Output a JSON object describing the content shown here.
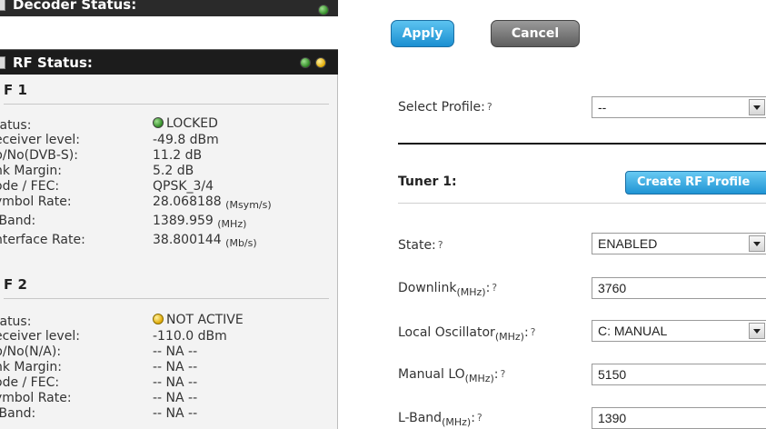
{
  "left": {
    "decoder_header": "Decoder Status:",
    "rf_header": "RF Status:",
    "rf1": {
      "title": "F 1",
      "rows": [
        {
          "label": "tatus:",
          "value": "LOCKED",
          "unit": ""
        },
        {
          "label": "eceiver level:",
          "value": "-49.8 dBm",
          "unit": ""
        },
        {
          "label": "b/No(DVB-S):",
          "value": "11.2 dB",
          "unit": ""
        },
        {
          "label": "nk Margin:",
          "value": "5.2 dB",
          "unit": ""
        },
        {
          "label": "ode / FEC:",
          "value": "QPSK_3/4",
          "unit": ""
        },
        {
          "label": "ymbol Rate:",
          "value": "28.068188",
          "unit": "(Msym/s)"
        },
        {
          "label": "-Band:",
          "value": "1389.959",
          "unit": "(MHz)"
        },
        {
          "label": "nterface Rate:",
          "value": "38.800144",
          "unit": "(Mb/s)"
        }
      ]
    },
    "rf2": {
      "title": "F 2",
      "rows": [
        {
          "label": "tatus:",
          "value": "NOT ACTIVE"
        },
        {
          "label": "eceiver level:",
          "value": "-110.0 dBm"
        },
        {
          "label": "b/No(N/A):",
          "value": "-- NA --"
        },
        {
          "label": "nk Margin:",
          "value": "-- NA --"
        },
        {
          "label": "ode / FEC:",
          "value": "-- NA --"
        },
        {
          "label": "ymbol Rate:",
          "value": "-- NA --"
        },
        {
          "label": "-Band:",
          "value": "-- NA --"
        }
      ]
    }
  },
  "right": {
    "apply_label": "Apply",
    "cancel_label": "Cancel",
    "select_profile_label": "Select Profile:",
    "help_glyph": "?",
    "select_profile_value": "--",
    "tuner_title": "Tuner 1:",
    "create_rf_profile_label": "Create RF Profile",
    "fields": {
      "state": {
        "label": "State:",
        "value": "ENABLED"
      },
      "downlink": {
        "label": "Downlink",
        "unit": "(MHz)",
        "value": "3760"
      },
      "local_osc": {
        "label": "Local Oscillator",
        "unit": "(MHz)",
        "value": "C: MANUAL"
      },
      "manual_lo": {
        "label": "Manual LO",
        "unit": "(MHz)",
        "value": "5150"
      },
      "lband": {
        "label": "L-Band",
        "unit": "(MHz)",
        "value": "1390"
      }
    }
  },
  "colors": {
    "header_bg": "#1c1c1c",
    "panel_bg": "#f3f3f3",
    "apply_blue": "#1b8fd1",
    "cancel_grey": "#5e5e5e",
    "status_green": "#2f8a24",
    "status_yellow": "#e0a800"
  }
}
